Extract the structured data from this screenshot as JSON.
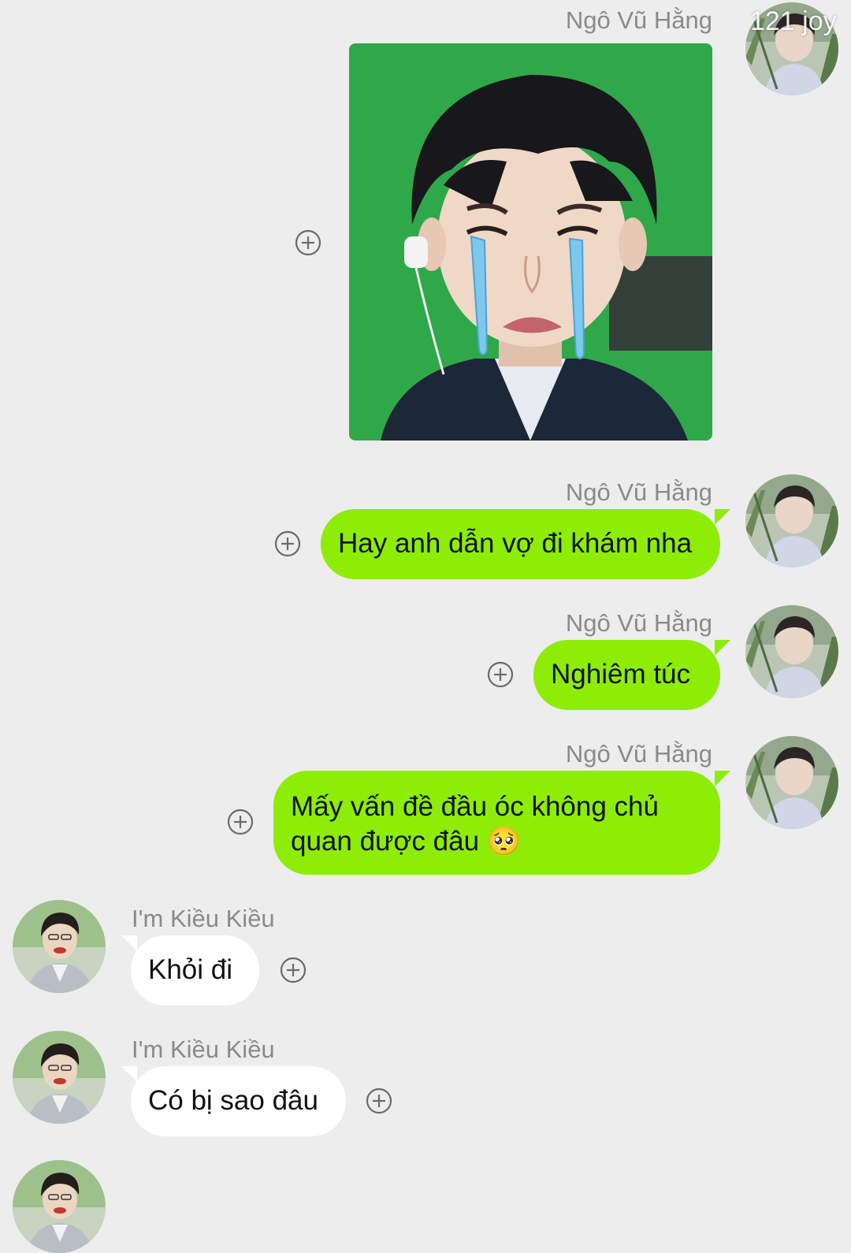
{
  "watermark": "121 joy",
  "colors": {
    "background": "#ededed",
    "outgoing_bubble": "#8ded06",
    "incoming_bubble": "#ffffff",
    "name_text": "#8a8a8a"
  },
  "messages": [
    {
      "sender": "Ngô Vũ Hằng",
      "side": "right",
      "type": "sticker",
      "sticker_icon": "crying-boy-sticker"
    },
    {
      "sender": "Ngô Vũ Hằng",
      "side": "right",
      "type": "text",
      "text": "Hay anh dẫn vợ đi khám nha"
    },
    {
      "sender": "Ngô Vũ Hằng",
      "side": "right",
      "type": "text",
      "text": "Nghiêm túc"
    },
    {
      "sender": "Ngô Vũ Hằng",
      "side": "right",
      "type": "text",
      "lines": [
        "Mấy vấn đề đầu óc không chủ",
        "quan được đâu"
      ],
      "emoji": "🥺"
    },
    {
      "sender": "I'm Kiều Kiều",
      "side": "left",
      "type": "text",
      "text": "Khỏi đi"
    },
    {
      "sender": "I'm Kiều Kiều",
      "side": "left",
      "type": "text",
      "text": "Có bị sao đâu"
    }
  ]
}
